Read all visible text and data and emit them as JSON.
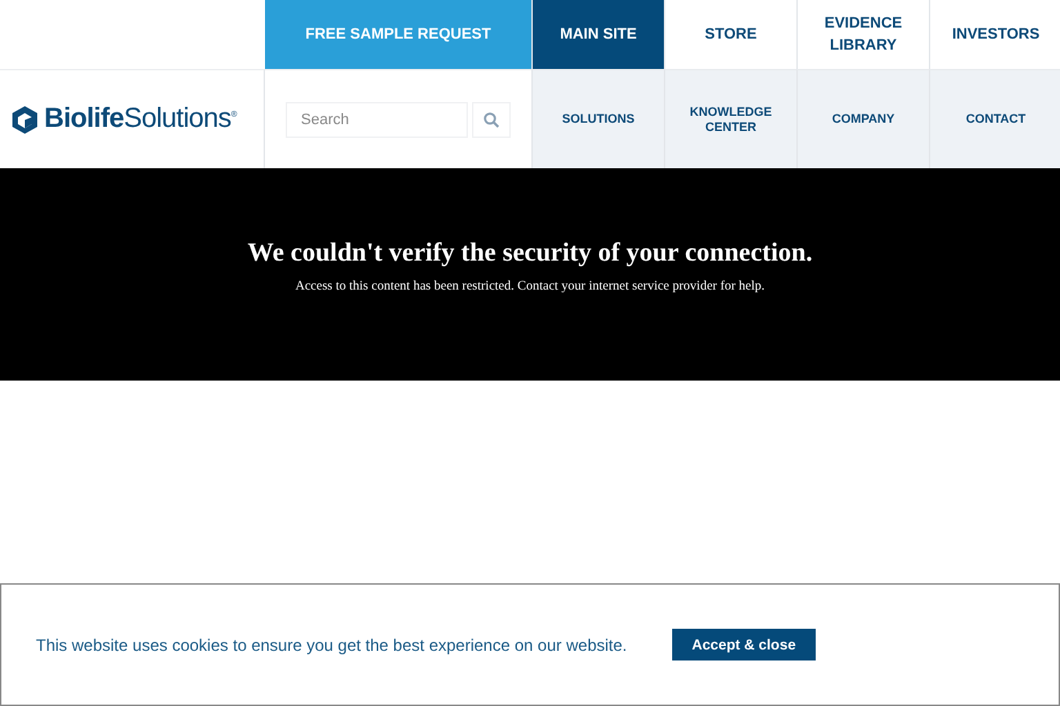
{
  "header": {
    "logo": {
      "name": "Biolife",
      "suffix": "Solutions",
      "mark": "®"
    },
    "sample_request": "FREE SAMPLE REQUEST",
    "top_nav": [
      {
        "label": "MAIN SITE",
        "selected": true
      },
      {
        "label": "STORE",
        "selected": false
      },
      {
        "label": "EVIDENCE LIBRARY",
        "selected": false
      },
      {
        "label": "INVESTORS",
        "selected": false
      }
    ],
    "search": {
      "placeholder": "Search"
    },
    "main_nav": [
      "SOLUTIONS",
      "KNOWLEDGE CENTER",
      "COMPANY",
      "CONTACT"
    ]
  },
  "notice": {
    "title": "We couldn't verify the security of your connection.",
    "message": "Access to this content has been restricted. Contact your internet service provider for help."
  },
  "cookie_banner": {
    "message": "This website uses cookies to ensure you get the best experience on our website.",
    "button": "Accept & close"
  }
}
